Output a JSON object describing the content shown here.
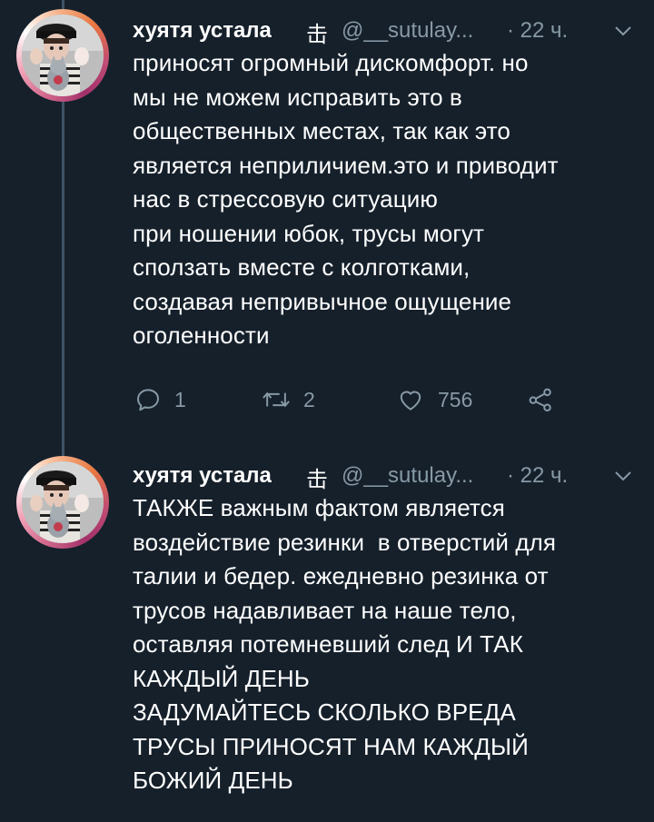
{
  "colors": {
    "background": "#15202b",
    "text": "#ffffff",
    "muted": "#8899a6",
    "thread_line": "#3d5466"
  },
  "tweets": [
    {
      "author": {
        "name": "хуятя устала",
        "badge": "击",
        "handle": "@__sutulay...",
        "avatar_icon": "avatar-image"
      },
      "time": "· 22 ч.",
      "menu_icon": "chevron-down-icon",
      "text": "приносят огромный дискомфорт. но\nмы не можем исправить это в\nобщественных местах, так как это\nявляется неприличием.это и приводит\nнас в стрессовую ситуацию\nпри ношении юбок, трусы могут\nсползать вместе с колготками,\nсоздавая непривычное ощущение\nоголенности",
      "actions": {
        "reply": {
          "icon": "reply-icon",
          "count": "1"
        },
        "retweet": {
          "icon": "retweet-icon",
          "count": "2"
        },
        "like": {
          "icon": "heart-icon",
          "count": "756"
        },
        "share": {
          "icon": "share-icon"
        }
      }
    },
    {
      "author": {
        "name": "хуятя устала",
        "badge": "击",
        "handle": "@__sutulay...",
        "avatar_icon": "avatar-image"
      },
      "time": "· 22 ч.",
      "menu_icon": "chevron-down-icon",
      "text": "ТАКЖЕ важным фактом является\nвоздействие резинки  в отверстий для\nталии и бедер. ежедневно резинка от\nтрусов надавливает на наше тело,\nоставляя потемневший след И ТАК\nКАЖДЫЙ ДЕНЬ\nЗАДУМАЙТЕСЬ СКОЛЬКО ВРЕДА\nТРУСЫ ПРИНОСЯТ НАМ КАЖДЫЙ\nБОЖИЙ ДЕНЬ"
    }
  ]
}
